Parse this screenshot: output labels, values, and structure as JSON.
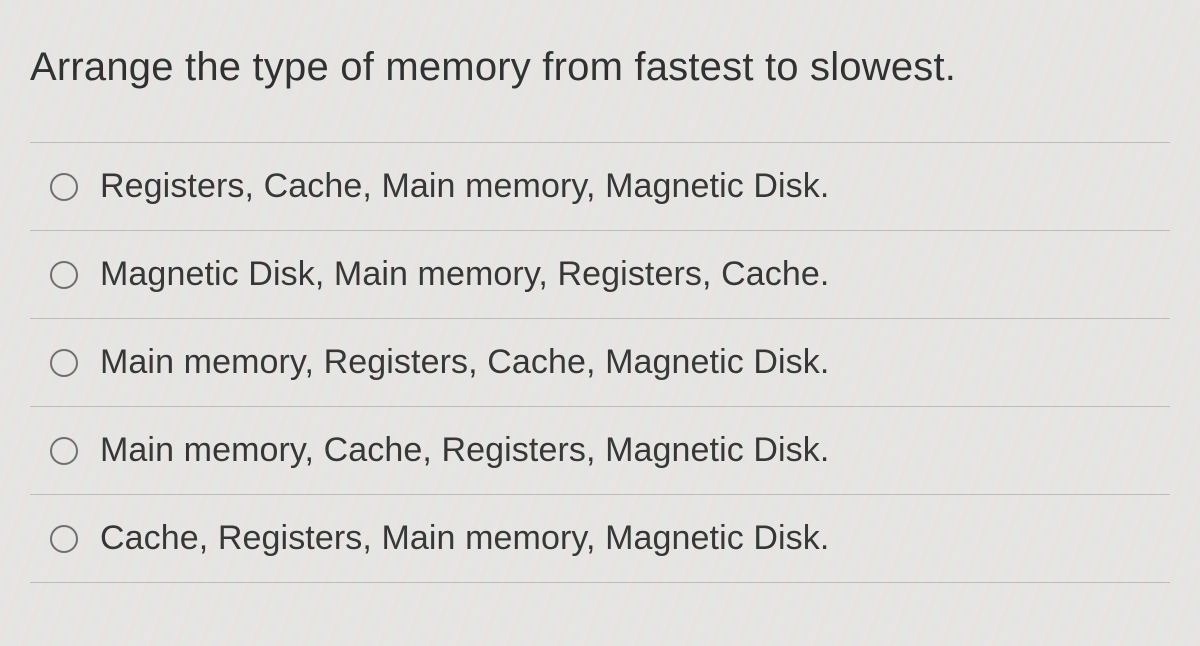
{
  "question": "Arrange the type of memory from fastest to slowest.",
  "options": [
    {
      "label": "Registers, Cache, Main memory, Magnetic Disk."
    },
    {
      "label": "Magnetic Disk, Main memory, Registers, Cache."
    },
    {
      "label": "Main memory, Registers, Cache, Magnetic Disk."
    },
    {
      "label": "Main memory, Cache, Registers, Magnetic Disk."
    },
    {
      "label": "Cache, Registers, Main memory, Magnetic Disk."
    }
  ]
}
